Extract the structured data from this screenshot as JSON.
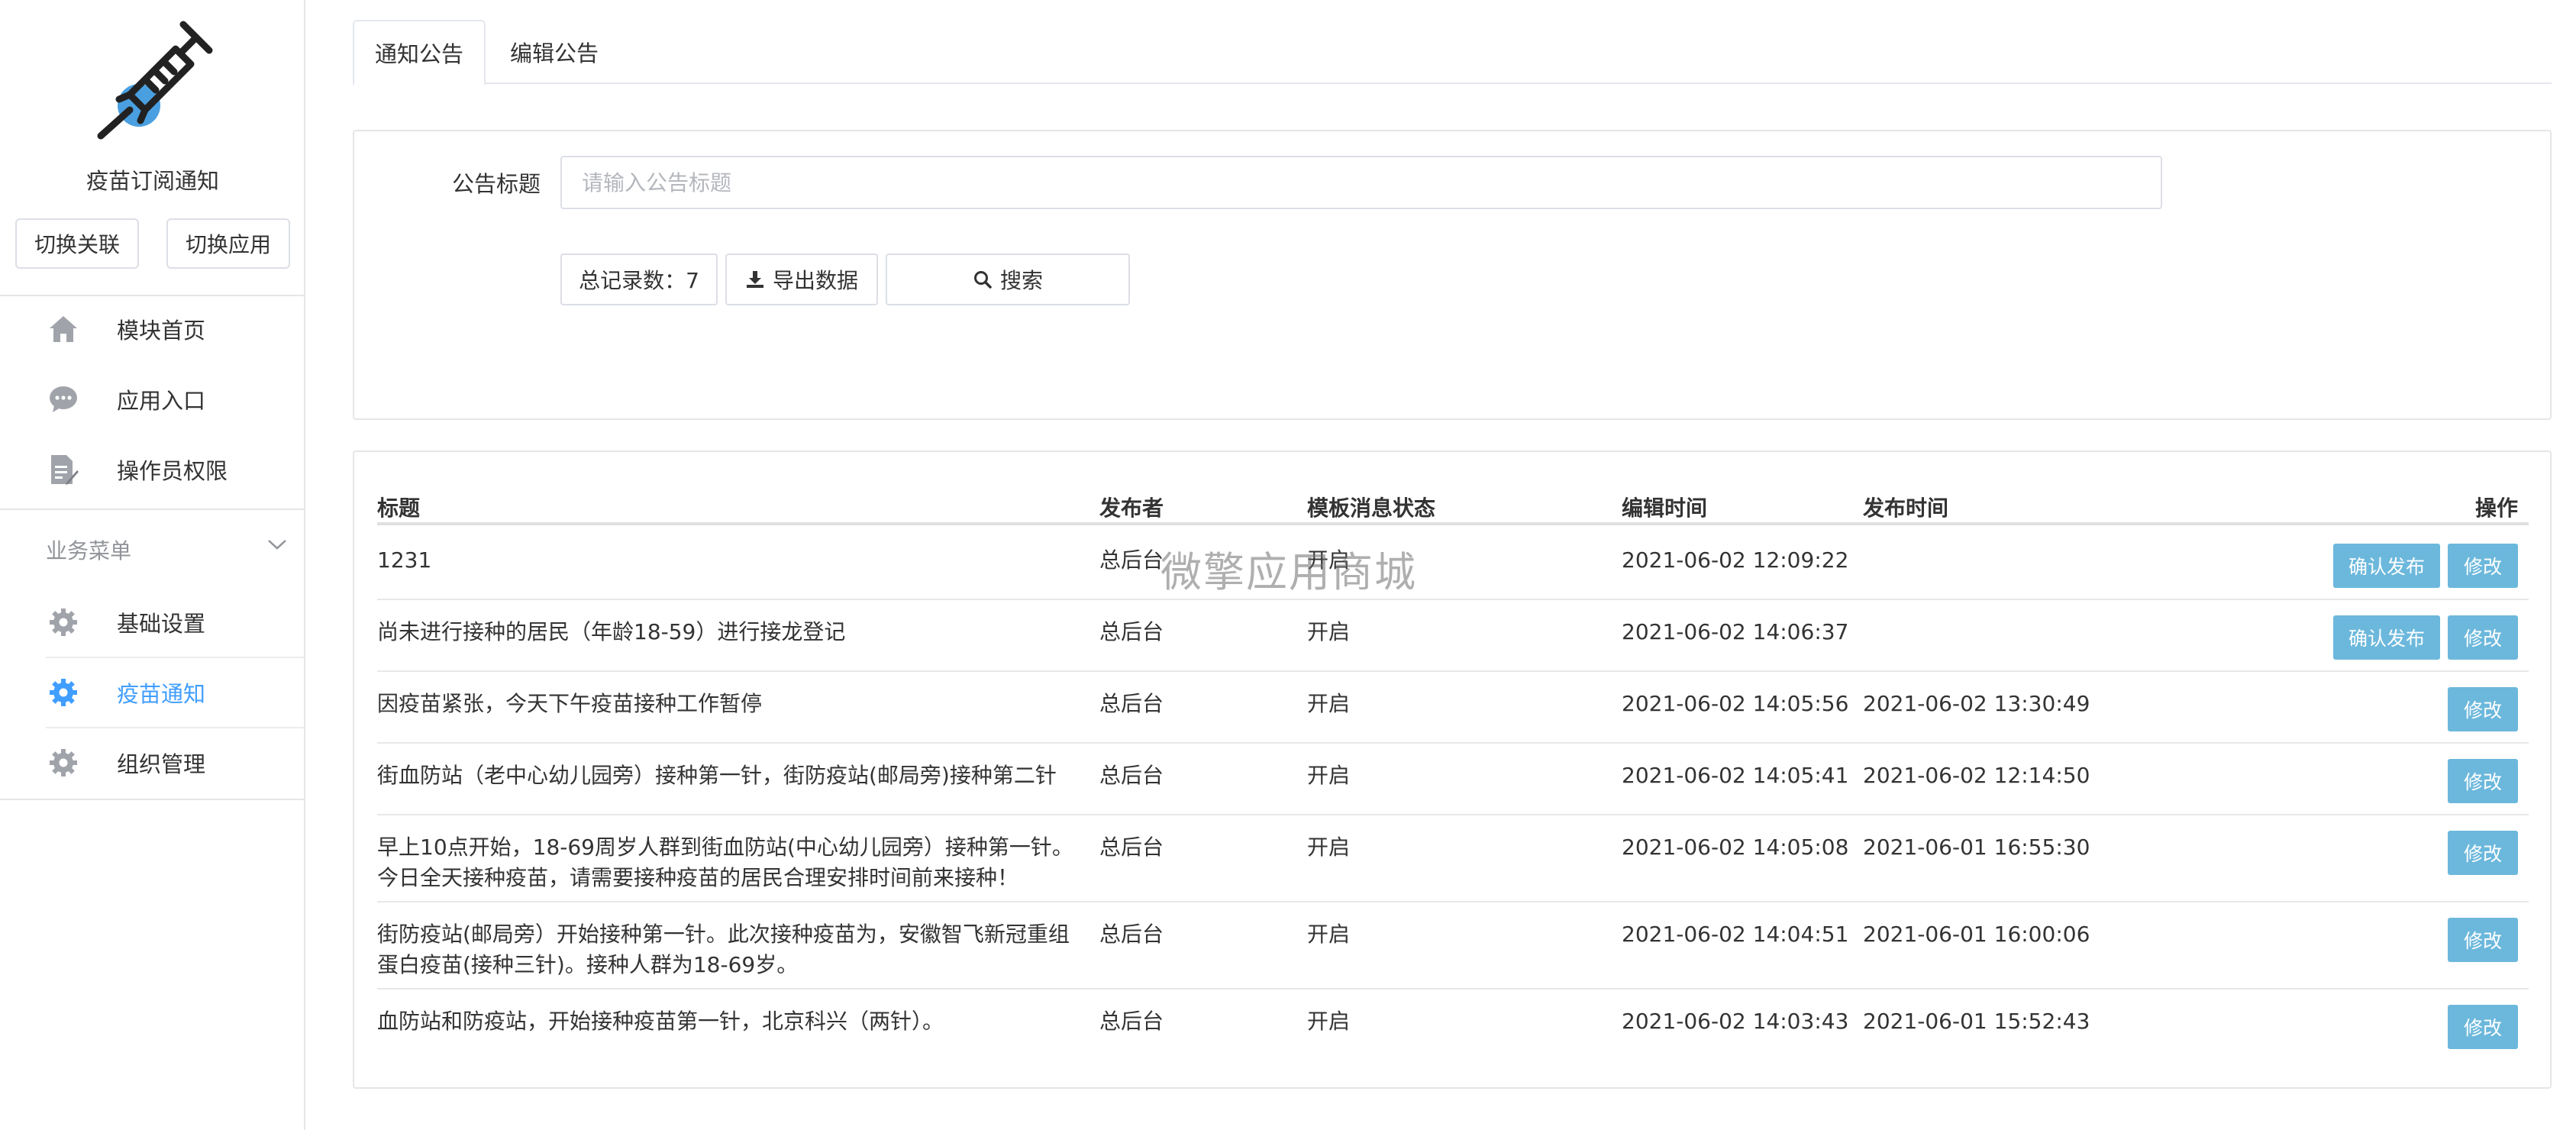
{
  "app": {
    "name": "疫苗订阅通知",
    "switch_link_label": "切换关联",
    "switch_app_label": "切换应用"
  },
  "sidebar": {
    "items": [
      {
        "label": "模块首页",
        "icon": "home-icon"
      },
      {
        "label": "应用入口",
        "icon": "chat-icon"
      },
      {
        "label": "操作员权限",
        "icon": "document-edit-icon"
      }
    ],
    "group_title": "业务菜单",
    "group_items": [
      {
        "label": "基础设置",
        "icon": "gear-icon"
      },
      {
        "label": "疫苗通知",
        "icon": "gear-icon",
        "active": true
      },
      {
        "label": "组织管理",
        "icon": "gear-icon"
      }
    ]
  },
  "tabs": [
    {
      "label": "通知公告",
      "active": true
    },
    {
      "label": "编辑公告",
      "active": false
    }
  ],
  "search": {
    "title_label": "公告标题",
    "title_placeholder": "请输入公告标题",
    "total_label": "总记录数：7",
    "export_label": "导出数据",
    "search_label": "搜索"
  },
  "table": {
    "columns": {
      "title": "标题",
      "publisher": "发布者",
      "status": "模板消息状态",
      "edit_time": "编辑时间",
      "publish_time": "发布时间",
      "ops": "操作"
    },
    "confirm_label": "确认发布",
    "edit_label": "修改",
    "rows": [
      {
        "title": "1231",
        "publisher": "总后台",
        "status": "开启",
        "edit_time": "2021-06-02 12:09:22",
        "publish_time": "",
        "confirm": true
      },
      {
        "title": "尚未进行接种的居民（年龄18-59）进行接龙登记",
        "publisher": "总后台",
        "status": "开启",
        "edit_time": "2021-06-02 14:06:37",
        "publish_time": "",
        "confirm": true
      },
      {
        "title": "因疫苗紧张，今天下午疫苗接种工作暂停",
        "publisher": "总后台",
        "status": "开启",
        "edit_time": "2021-06-02 14:05:56",
        "publish_time": "2021-06-02 13:30:49",
        "confirm": false
      },
      {
        "title": "街血防站（老中心幼儿园旁）接种第一针，街防疫站(邮局旁)接种第二针",
        "publisher": "总后台",
        "status": "开启",
        "edit_time": "2021-06-02 14:05:41",
        "publish_time": "2021-06-02 12:14:50",
        "confirm": false
      },
      {
        "title": "早上10点开始，18-69周岁人群到街血防站(中心幼儿园旁）接种第一针。今日全天接种疫苗，请需要接种疫苗的居民合理安排时间前来接种！",
        "publisher": "总后台",
        "status": "开启",
        "edit_time": "2021-06-02 14:05:08",
        "publish_time": "2021-06-01 16:55:30",
        "confirm": false
      },
      {
        "title": "街防疫站(邮局旁）开始接种第一针。此次接种疫苗为，安徽智飞新冠重组蛋白疫苗(接种三针)。接种人群为18-69岁。",
        "publisher": "总后台",
        "status": "开启",
        "edit_time": "2021-06-02 14:04:51",
        "publish_time": "2021-06-01 16:00:06",
        "confirm": false
      },
      {
        "title": "血防站和防疫站，开始接种疫苗第一针，北京科兴（两针）。",
        "publisher": "总后台",
        "status": "开启",
        "edit_time": "2021-06-02 14:03:43",
        "publish_time": "2021-06-01 15:52:43",
        "confirm": false
      }
    ]
  },
  "watermark": "微擎应用商城",
  "colors": {
    "accent": "#409eff",
    "button": "#6cb8dc",
    "icon_gray": "#a0a4aa"
  }
}
